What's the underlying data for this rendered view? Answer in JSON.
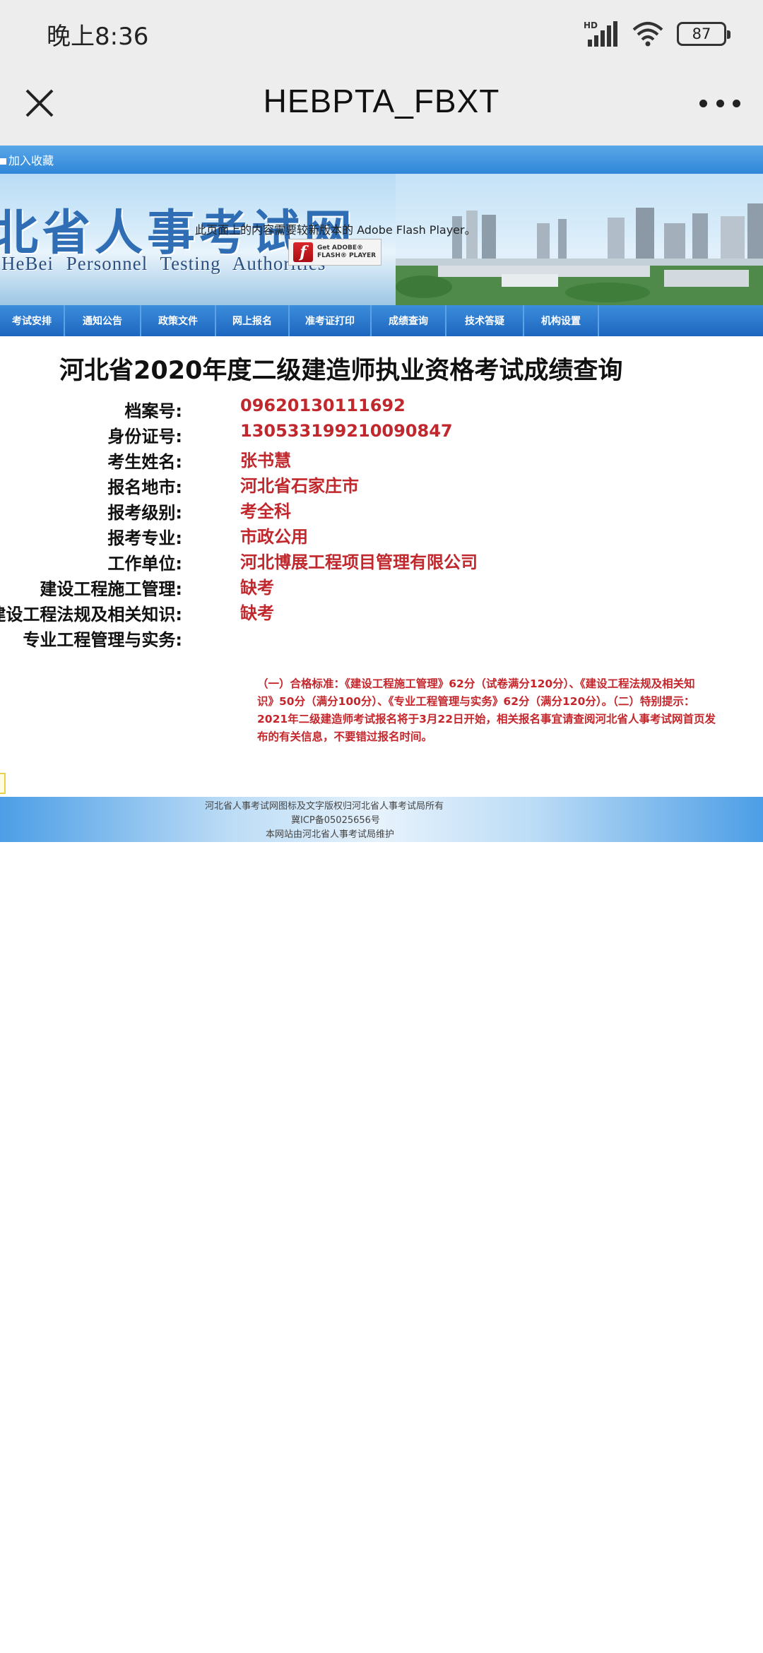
{
  "status_bar": {
    "time": "晚上8:36",
    "signal_label": "HD",
    "battery": "87"
  },
  "title_bar": {
    "title": "HEBPTA_FBXT",
    "close_icon": "close-icon",
    "more_icon": "more-icon"
  },
  "webpage": {
    "favorite_link": "加入收藏",
    "banner": {
      "title_cn": "北省人事考试网",
      "title_en": "HeBei Personnel Testing Authorities",
      "flash_message": "此页面上的内容需要较新版本的 Adobe Flash Player。",
      "flash_button_line1": "Get ADOBE®",
      "flash_button_line2": "FLASH® PLAYER"
    },
    "nav": [
      "考试安排",
      "通知公告",
      "政策文件",
      "网上报名",
      "准考证打印",
      "成绩查询",
      "技术答疑",
      "机构设置"
    ],
    "main_title": "河北省2020年度二级建造师执业资格考试成绩查询",
    "fields": [
      {
        "label": "档案号:",
        "value": "09620130111692"
      },
      {
        "label": "身份证号:",
        "value": "130533199210090847"
      },
      {
        "label": "考生姓名:",
        "value": "张书慧"
      },
      {
        "label": "报名地市:",
        "value": "河北省石家庄市"
      },
      {
        "label": "报考级别:",
        "value": "考全科"
      },
      {
        "label": "报考专业:",
        "value": "市政公用"
      },
      {
        "label": "工作单位:",
        "value": "河北博展工程项目管理有限公司"
      },
      {
        "label": "建设工程施工管理:",
        "value": "缺考"
      },
      {
        "label": "建设工程法规及相关知识:",
        "value": "缺考"
      },
      {
        "label": "专业工程管理与实务:",
        "value": ""
      }
    ],
    "note_lines": [
      "（一）合格标准：《建设工程施工管理》62分（试卷满分120分）、《建设工程法规及相关知",
      "识》50分（满分100分）、《专业工程管理与实务》62分（满分120分）。（二）特别提示：",
      "2021年二级建造师考试报名将于3月22日开始，相关报名事宜请查阅河北省人事考试网首页发",
      "布的有关信息，不要错过报名时间。"
    ],
    "footer": {
      "copyright": "河北省人事考试网图标及文字版权归河北省人事考试局所有",
      "icp": "冀ICP备05025656号",
      "maintained_by": "本网站由河北省人事考试局维护"
    }
  }
}
